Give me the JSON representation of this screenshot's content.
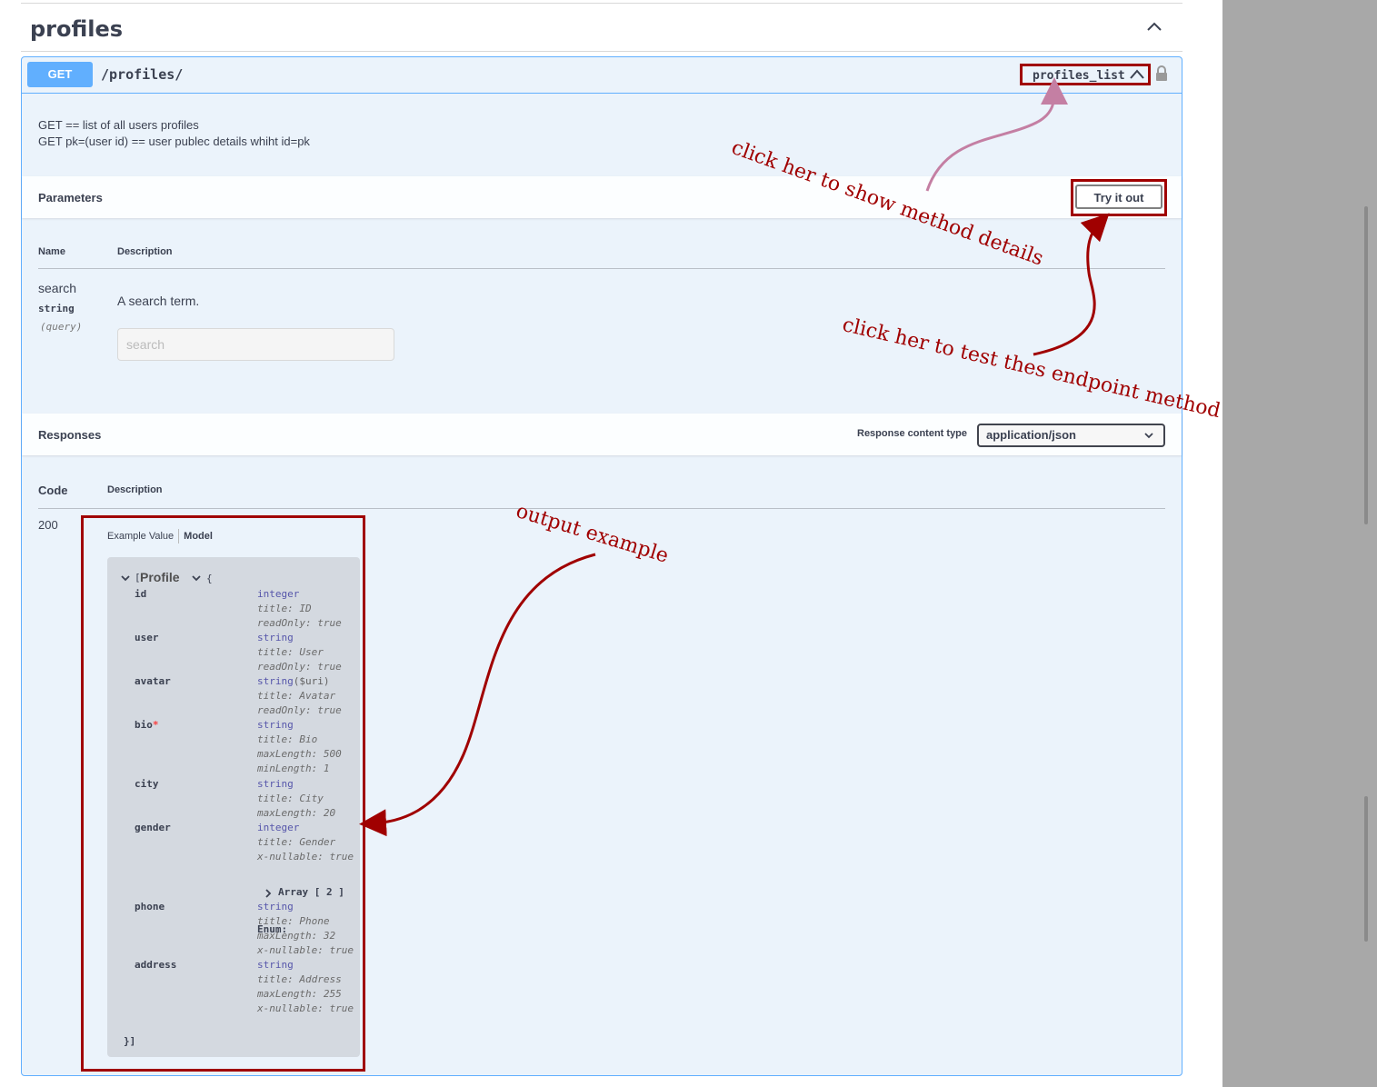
{
  "section": {
    "title": "profiles"
  },
  "operation": {
    "method": "GET",
    "path": "/profiles/",
    "operation_id": "profiles_list",
    "description_lines": [
      "GET == list of all users profiles",
      "GET pk=(user id) == user publec details whiht id=pk"
    ]
  },
  "parameters": {
    "title": "Parameters",
    "try_label": "Try it out",
    "col_name": "Name",
    "col_description": "Description",
    "param": {
      "name": "search",
      "type": "string",
      "in": "(query)",
      "description": "A search term.",
      "placeholder": "search"
    }
  },
  "responses": {
    "title": "Responses",
    "content_type_label": "Response content type",
    "content_type_value": "application/json",
    "col_code": "Code",
    "col_description": "Description",
    "code": "200",
    "tab_example": "Example Value",
    "tab_model": "Model",
    "model": {
      "open": "[",
      "name": "Profile",
      "brace": "{",
      "close": "}]",
      "array_label": "Array [ 2 ]",
      "enum_label": "Enum:",
      "properties": [
        {
          "name": "id",
          "type": "integer",
          "meta": [
            "title: ID",
            "readOnly: true"
          ]
        },
        {
          "name": "user",
          "type": "string",
          "meta": [
            "title: User",
            "readOnly: true"
          ]
        },
        {
          "name": "avatar",
          "type": "string",
          "format": "($uri)",
          "meta": [
            "title: Avatar",
            "readOnly: true"
          ]
        },
        {
          "name": "bio",
          "required": "*",
          "type": "string",
          "meta": [
            "title: Bio",
            "maxLength: 500",
            "minLength: 1"
          ]
        },
        {
          "name": "city",
          "type": "string",
          "meta": [
            "title: City",
            "maxLength: 20"
          ]
        },
        {
          "name": "gender",
          "type": "integer",
          "meta": [
            "title: Gender",
            "x-nullable: true"
          ]
        },
        {
          "name": "phone",
          "type": "string",
          "meta": [
            "title: Phone",
            "maxLength: 32",
            "x-nullable: true"
          ]
        },
        {
          "name": "address",
          "type": "string",
          "meta": [
            "title: Address",
            "maxLength: 255",
            "x-nullable: true"
          ]
        }
      ]
    }
  },
  "annotations": {
    "details": "click her to show method details",
    "test": "click her to test thes endpoint method",
    "output": "output example"
  },
  "colors": {
    "get": "#61affe",
    "annotation": "#a00000",
    "annotation_light": "#c47fa3"
  }
}
